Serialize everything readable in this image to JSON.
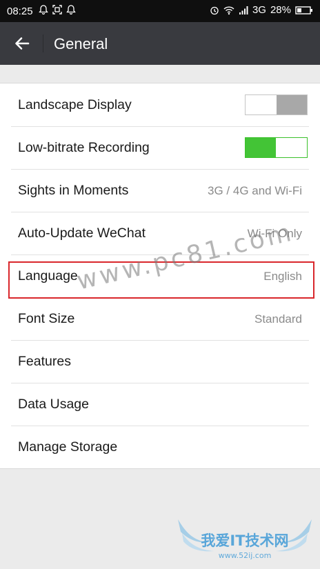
{
  "status_bar": {
    "time": "08:25",
    "network": "3G",
    "battery": "28%",
    "left_icons": [
      "notification-bell-icon",
      "screenshot-icon",
      "notification-bell-icon"
    ],
    "right_icons": [
      "alarm-icon",
      "wifi-icon",
      "signal-icon",
      "battery-icon"
    ]
  },
  "app_bar": {
    "title": "General",
    "back_icon": "arrow-left-icon"
  },
  "settings": {
    "rows": [
      {
        "label": "Landscape Display",
        "toggle": false
      },
      {
        "label": "Low-bitrate Recording",
        "toggle": true
      },
      {
        "label": "Sights in Moments",
        "value": "3G / 4G and Wi-Fi"
      },
      {
        "label": "Auto-Update WeChat",
        "value": "Wi-Fi Only"
      },
      {
        "label": "Language",
        "value": "English"
      },
      {
        "label": "Font Size",
        "value": "Standard"
      },
      {
        "label": "Features"
      },
      {
        "label": "Data Usage"
      },
      {
        "label": "Manage Storage"
      }
    ]
  },
  "annotations": {
    "highlight_color": "#d9262b",
    "watermark": "www.pc81.com",
    "corner_logo_text": "我爱IT技术网",
    "corner_logo_url": "www.52ij.com"
  },
  "colors": {
    "app_bar": "#393a3f",
    "status_bar": "#0f0f0f",
    "toggle_on": "#43c436",
    "toggle_off": "#a8a8a8",
    "background": "#ebebeb"
  }
}
